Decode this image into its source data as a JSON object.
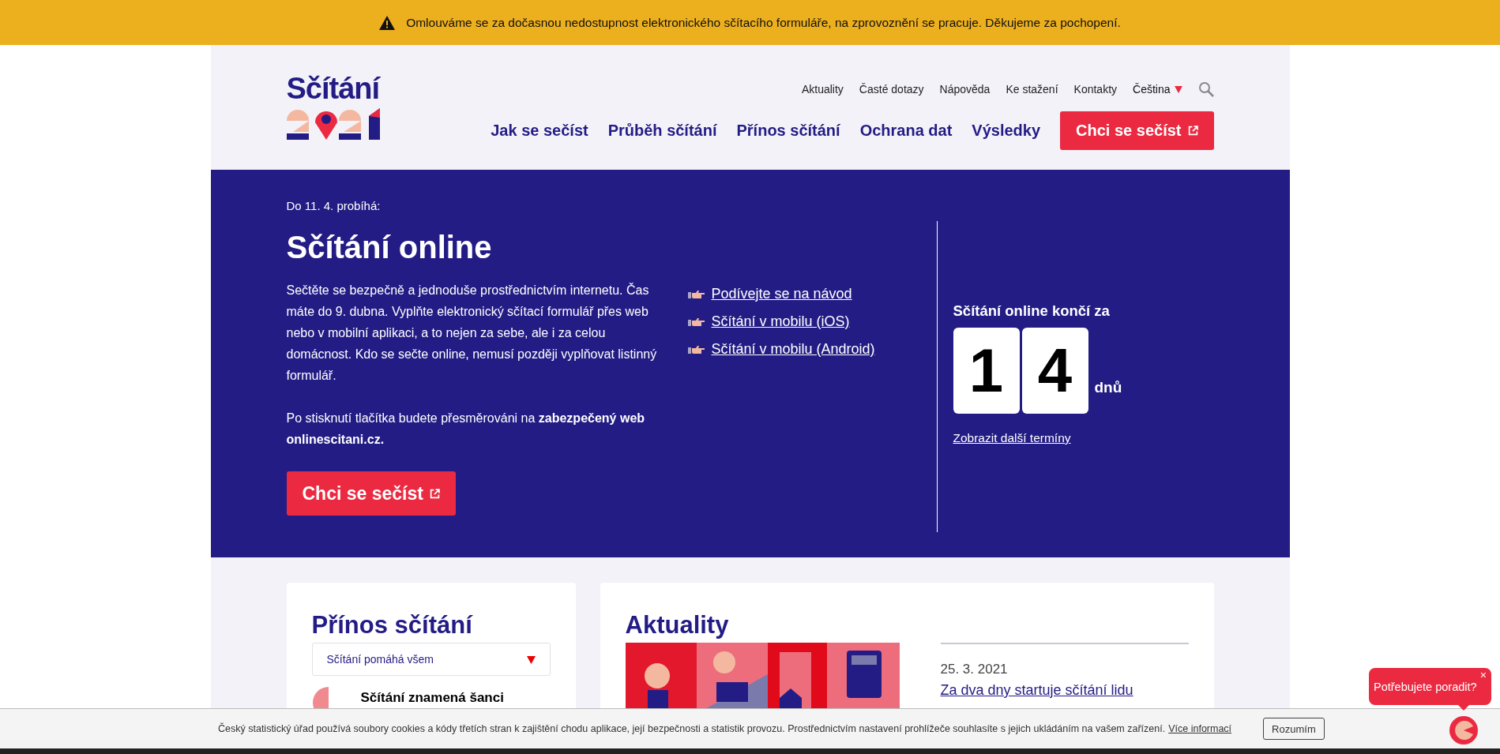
{
  "alert": {
    "text": "Omlouváme se za dočasnou nedostupnost elektronického sčítacího formuláře, na zprovoznění se pracuje. Děkujeme za pochopení."
  },
  "logo": {
    "text": "Sčítání"
  },
  "top_links": [
    {
      "label": "Aktuality"
    },
    {
      "label": "Časté dotazy"
    },
    {
      "label": "Nápověda"
    },
    {
      "label": "Ke stažení"
    },
    {
      "label": "Kontakty"
    }
  ],
  "language": {
    "label": "Čeština"
  },
  "main_nav": [
    {
      "label": "Jak se sečíst"
    },
    {
      "label": "Průběh sčítání"
    },
    {
      "label": "Přínos sčítání"
    },
    {
      "label": "Ochrana dat"
    },
    {
      "label": "Výsledky"
    }
  ],
  "cta": {
    "label": "Chci se sečíst"
  },
  "hero": {
    "eyebrow": "Do 11. 4. probíhá:",
    "title": "Sčítání online",
    "paragraphs": [
      "Sečtěte se bezpečně a jednoduše prostřednictvím internetu. Čas máte do 9. dubna. Vyplňte elektronický sčítací formulář přes web nebo v mobilní aplikaci, a to nejen za sebe, ale i za celou domácnost. Kdo se sečte online, nemusí později vyplňovat listinný formulář.",
      "Po stisknutí tlačítka budete přesměrováni na **zabezpečený web onlinescitani.cz.**"
    ],
    "button": "Chci se sečíst",
    "links": [
      {
        "label": "Podívejte se na návod"
      },
      {
        "label": "Sčítání v mobilu (iOS)"
      },
      {
        "label": "Sčítání v mobilu (Android)"
      }
    ],
    "countdown": {
      "title": "Sčítání online končí za",
      "digits": [
        "1",
        "4"
      ],
      "unit": "dnů",
      "link": "Zobrazit další termíny"
    }
  },
  "benefits": {
    "title": "Přínos sčítání",
    "select": "Sčítání pomáhá všem",
    "item": "Sčítání znamená šanci"
  },
  "news": {
    "title": "Aktuality",
    "items": [
      {
        "date": "25. 3. 2021",
        "title": "Za dva dny startuje sčítání lidu"
      }
    ]
  },
  "cookie": {
    "text": "Český statistický úřad používá soubory cookies a kódy třetích stran k zajištění chodu aplikace, její bezpečnosti a statistik provozu. Prostřednictvím nastavení prohlížeče souhlasíte s jejich ukládáním na vašem zařízení.",
    "link": "Více informací",
    "button": "Rozumím"
  },
  "chat": {
    "text": "Potřebujete poradit?",
    "close": "×"
  }
}
